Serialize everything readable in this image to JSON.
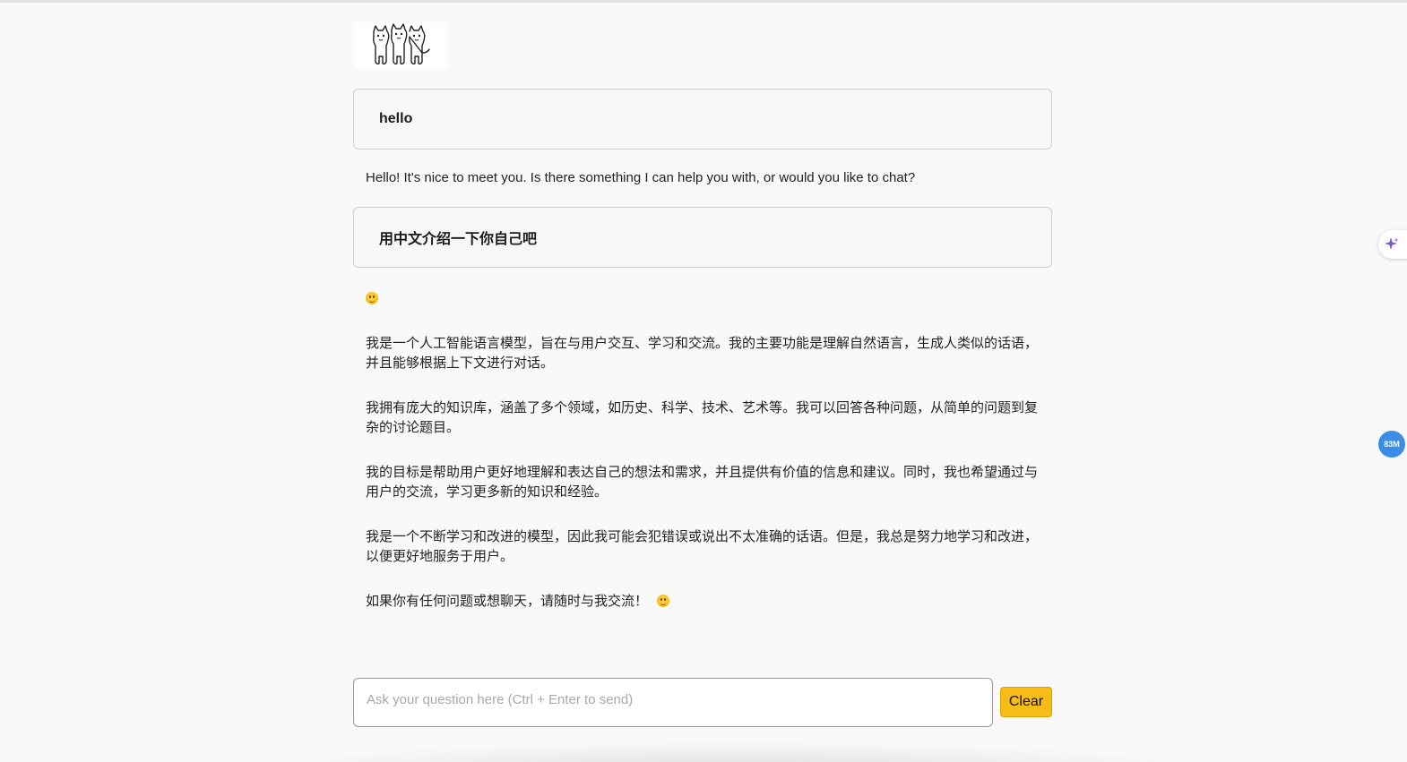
{
  "logo": {
    "icon": "alpaca-trio-icon"
  },
  "conversation": [
    {
      "role": "user",
      "text": "hello"
    },
    {
      "role": "assistant",
      "paragraphs": [
        "Hello! It's nice to meet you. Is there something I can help you with, or would you like to chat?"
      ]
    },
    {
      "role": "user",
      "text": "用中文介绍一下你自己吧"
    },
    {
      "role": "assistant",
      "paragraphs": [
        "我是一个人工智能语言模型，旨在与用户交互、学习和交流。我的主要功能是理解自然语言，生成人类似的话语，并且能够根据上下文进行对话。",
        "我拥有庞大的知识库，涵盖了多个领域，如历史、科学、技术、艺术等。我可以回答各种问题，从简单的问题到复杂的讨论题目。",
        "我的目标是帮助用户更好地理解和表达自己的想法和需求，并且提供有价值的信息和建议。同时，我也希望通过与用户的交流，学习更多新的知识和经验。",
        "我是一个不断学习和改进的模型，因此我可能会犯错误或说出不太准确的话语。但是，我总是努力地学习和改进，以便更好地服务于用户。",
        "如果你有任何问题或想聊天，请随时与我交流！"
      ]
    }
  ],
  "input": {
    "placeholder": "Ask your question here (Ctrl + Enter to send)",
    "value": ""
  },
  "clear_label": "Clear",
  "side": {
    "sparkle_icon": "sparkle-icon",
    "memory_badge": "83M"
  },
  "colors": {
    "accent": "#f6bd16",
    "badge": "#3b8de6",
    "sparkle": "#7b5cc4"
  }
}
